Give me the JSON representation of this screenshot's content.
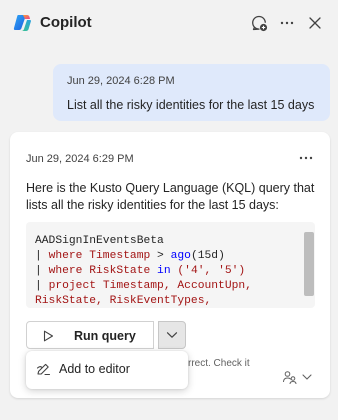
{
  "app": {
    "title": "Copilot",
    "logo_icon": "copilot-logo",
    "header_actions": [
      "new-chat-icon",
      "more-options-icon",
      "close-icon"
    ]
  },
  "user_message": {
    "timestamp": "Jun 29, 2024 6:28 PM",
    "text": "List all the risky identities for the last 15 days"
  },
  "response": {
    "timestamp": "Jun 29, 2024 6:29 PM",
    "intro": "Here is the Kusto Query Language (KQL) query that lists all the risky identities for the last 15 days:",
    "code": {
      "table": "AADSignInEventsBeta",
      "pipe": "|",
      "kw_where": "where",
      "kw_project": "project",
      "line2_field": "Timestamp",
      "line2_op": ">",
      "line2_fn": "ago",
      "line2_arg": "(15d)",
      "line3_field": "RiskState",
      "line3_op": "in",
      "line3_args": "('4', '5')",
      "line4_args": "Timestamp, AccountUpn,",
      "line5_args": "RiskState, RiskEventTypes,"
    },
    "run_button_label": "Run query",
    "disclaimer_partial": "rrect. Check it"
  },
  "dropdown_menu": {
    "items": [
      {
        "label": "Add to editor",
        "icon": "add-to-editor-icon"
      }
    ]
  },
  "colors": {
    "background": "#f2f2f2",
    "user_bubble": "#dfe9fb",
    "card": "#ffffff",
    "code_bg": "#f5f5f5",
    "keyword_red": "#a31515",
    "keyword_blue": "#0000ff",
    "function": "#795e26"
  }
}
